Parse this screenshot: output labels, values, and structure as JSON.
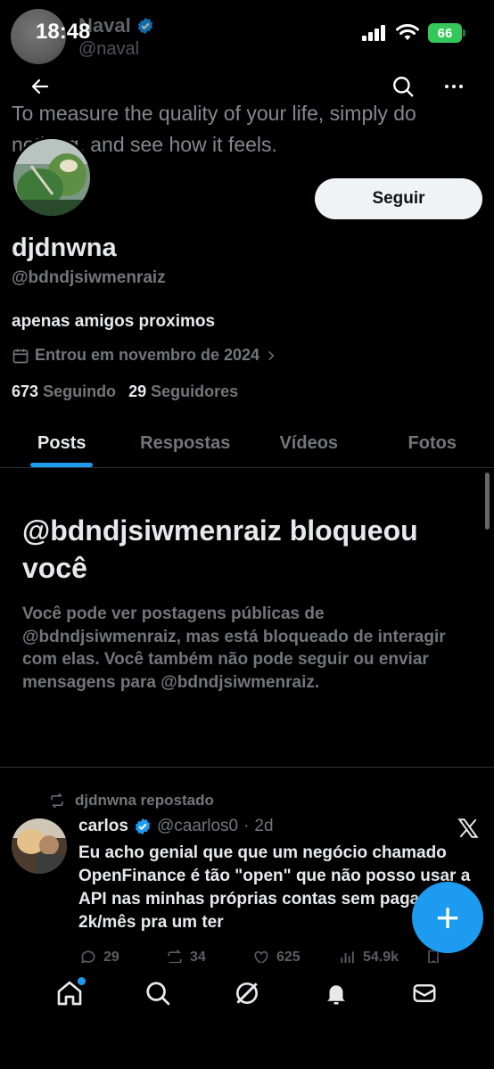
{
  "status_bar": {
    "time": "18:48",
    "battery": "66"
  },
  "ghost": {
    "name": "Naval",
    "handle": "@naval",
    "bio": "To measure the quality of your life, simply do nothing, and see how it feels."
  },
  "profile": {
    "display_name": "djdnwna",
    "handle": "@bdndjsiwmenraiz",
    "bio": "apenas amigos proximos",
    "joined": "Entrou em novembro de 2024",
    "following_count": "673",
    "following_label": "Seguindo",
    "followers_count": "29",
    "followers_label": "Seguidores",
    "follow_button": "Seguir"
  },
  "tabs": [
    {
      "label": "Posts",
      "active": true
    },
    {
      "label": "Respostas",
      "active": false
    },
    {
      "label": "Vídeos",
      "active": false
    },
    {
      "label": "Fotos",
      "active": false
    }
  ],
  "blocked": {
    "title": "@bdndjsiwmenraiz bloqueou você",
    "description": "Você pode ver postagens públicas de @bdndjsiwmenraiz, mas está bloqueado de interagir com elas. Você também não pode seguir ou enviar mensagens para @bdndjsiwmenraiz."
  },
  "post": {
    "repost_label": "djdnwna repostado",
    "author": "carlos",
    "handle": "@caarlos0",
    "separator": "·",
    "time": "2d",
    "text": "Eu acho genial que que um negócio chamado OpenFinance é tão \"open\" que não posso usar a API nas minhas próprias contas sem pagar 2k/mês pra um ter",
    "replies": "29",
    "reposts": "34",
    "likes": "625",
    "views": "54.9k"
  },
  "fab_label": "+",
  "colors": {
    "accent": "#1d9bf0",
    "background": "#000000",
    "text": "#e7e9ea",
    "muted": "#71767b",
    "battery": "#34c759"
  },
  "icons": [
    "back-arrow-icon",
    "search-icon",
    "more-icon",
    "calendar-icon",
    "chevron-right-icon",
    "repost-icon",
    "verified-icon",
    "x-logo-icon",
    "reply-icon",
    "like-icon",
    "views-icon",
    "bookmark-icon",
    "share-icon",
    "home-icon",
    "explore-icon",
    "grok-icon",
    "notifications-icon",
    "messages-icon"
  ]
}
